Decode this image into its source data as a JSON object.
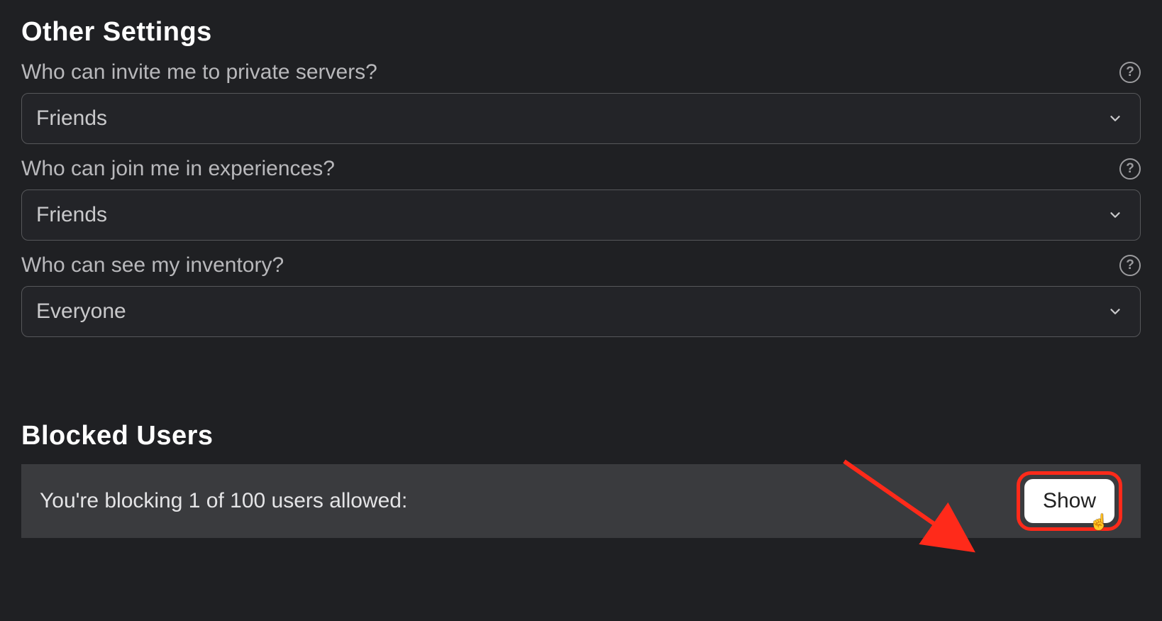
{
  "otherSettings": {
    "title": "Other Settings",
    "items": [
      {
        "label": "Who can invite me to private servers?",
        "value": "Friends"
      },
      {
        "label": "Who can join me in experiences?",
        "value": "Friends"
      },
      {
        "label": "Who can see my inventory?",
        "value": "Everyone"
      }
    ]
  },
  "blockedUsers": {
    "title": "Blocked Users",
    "status": "You're blocking 1 of 100 users allowed:",
    "button": "Show"
  },
  "helpGlyph": "?"
}
